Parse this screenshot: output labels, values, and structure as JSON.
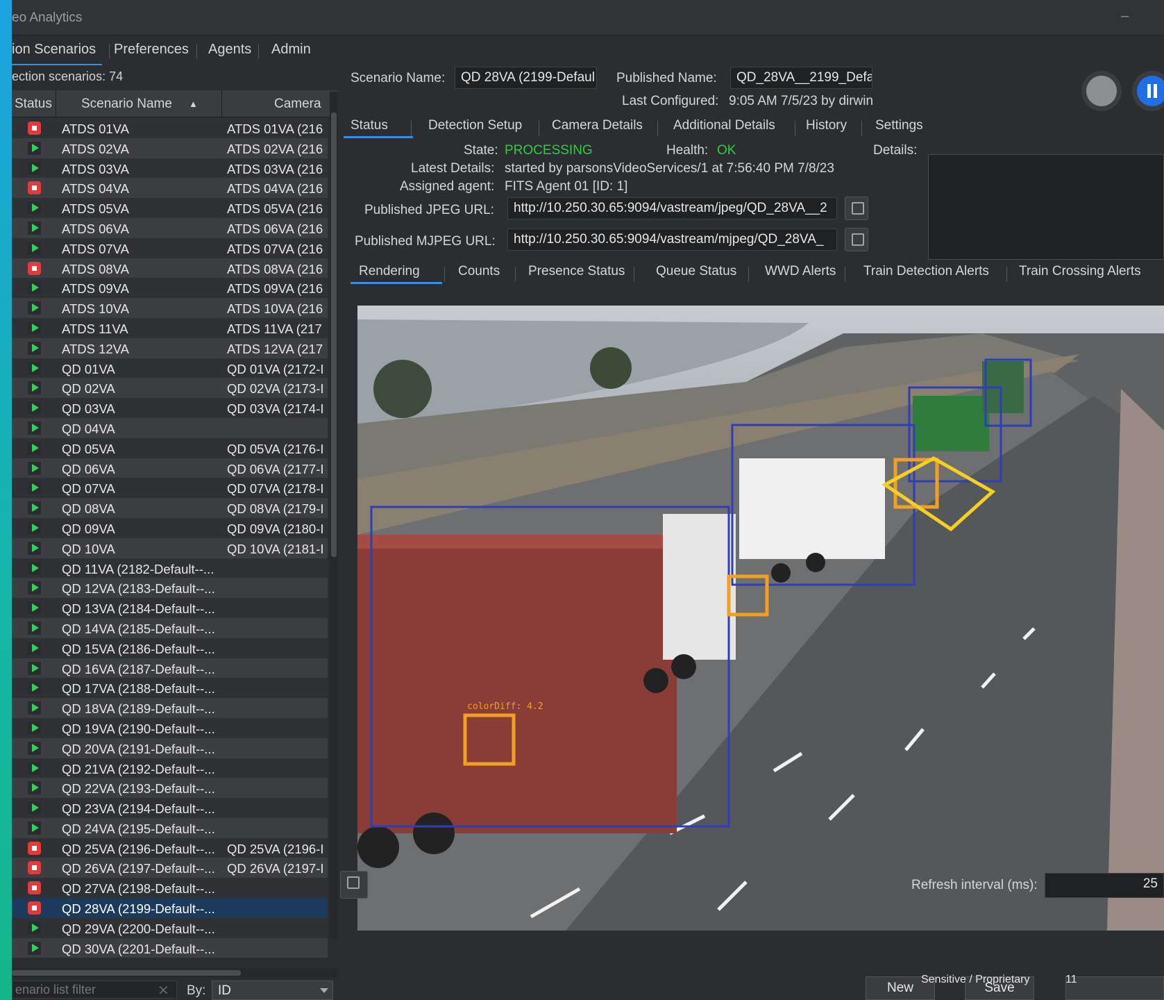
{
  "window": {
    "title": "eo Analytics"
  },
  "nav": {
    "tabs": [
      "ion Scenarios",
      "Preferences",
      "Agents",
      "Admin"
    ]
  },
  "left": {
    "count_label": "ection scenarios: 74",
    "headers": {
      "status": "Status",
      "name": "Scenario Name",
      "camera": "Camera"
    },
    "rows": [
      {
        "status": "stopped",
        "name": "ATDS 01VA",
        "camera": "ATDS 01VA (216"
      },
      {
        "status": "running",
        "name": "ATDS 02VA",
        "camera": "ATDS 02VA (216"
      },
      {
        "status": "running",
        "name": "ATDS 03VA",
        "camera": "ATDS 03VA (216"
      },
      {
        "status": "stopped",
        "name": "ATDS 04VA",
        "camera": "ATDS 04VA (216"
      },
      {
        "status": "running",
        "name": "ATDS 05VA",
        "camera": "ATDS 05VA (216"
      },
      {
        "status": "running",
        "name": "ATDS 06VA",
        "camera": "ATDS 06VA (216"
      },
      {
        "status": "running",
        "name": "ATDS 07VA",
        "camera": "ATDS 07VA (216"
      },
      {
        "status": "stopped",
        "name": "ATDS 08VA",
        "camera": "ATDS 08VA (216"
      },
      {
        "status": "running",
        "name": "ATDS 09VA",
        "camera": "ATDS 09VA (216"
      },
      {
        "status": "running",
        "name": "ATDS 10VA",
        "camera": "ATDS 10VA (216"
      },
      {
        "status": "running",
        "name": "ATDS 11VA",
        "camera": "ATDS 11VA (217"
      },
      {
        "status": "running",
        "name": "ATDS 12VA",
        "camera": "ATDS 12VA (217"
      },
      {
        "status": "running",
        "name": "QD 01VA",
        "camera": "QD 01VA (2172-I"
      },
      {
        "status": "running",
        "name": "QD 02VA",
        "camera": "QD 02VA (2173-I"
      },
      {
        "status": "running",
        "name": "QD 03VA",
        "camera": "QD 03VA (2174-I"
      },
      {
        "status": "running",
        "name": "QD 04VA",
        "camera": ""
      },
      {
        "status": "running",
        "name": "QD 05VA",
        "camera": "QD 05VA (2176-I"
      },
      {
        "status": "running",
        "name": "QD 06VA",
        "camera": "QD 06VA (2177-I"
      },
      {
        "status": "running",
        "name": "QD 07VA",
        "camera": "QD 07VA (2178-I"
      },
      {
        "status": "running",
        "name": "QD 08VA",
        "camera": "QD 08VA (2179-I"
      },
      {
        "status": "running",
        "name": "QD 09VA",
        "camera": "QD 09VA (2180-I"
      },
      {
        "status": "running",
        "name": "QD 10VA",
        "camera": "QD 10VA (2181-I"
      },
      {
        "status": "running",
        "name": "QD 11VA (2182-Default--...",
        "camera": ""
      },
      {
        "status": "running",
        "name": "QD 12VA (2183-Default--...",
        "camera": ""
      },
      {
        "status": "running",
        "name": "QD 13VA (2184-Default--...",
        "camera": ""
      },
      {
        "status": "running",
        "name": "QD 14VA (2185-Default--...",
        "camera": ""
      },
      {
        "status": "running",
        "name": "QD 15VA (2186-Default--...",
        "camera": ""
      },
      {
        "status": "running",
        "name": "QD 16VA (2187-Default--...",
        "camera": ""
      },
      {
        "status": "running",
        "name": "QD 17VA (2188-Default--...",
        "camera": ""
      },
      {
        "status": "running",
        "name": "QD 18VA (2189-Default--...",
        "camera": ""
      },
      {
        "status": "running",
        "name": "QD 19VA (2190-Default--...",
        "camera": ""
      },
      {
        "status": "running",
        "name": "QD 20VA (2191-Default--...",
        "camera": ""
      },
      {
        "status": "running",
        "name": "QD 21VA (2192-Default--...",
        "camera": ""
      },
      {
        "status": "running",
        "name": "QD 22VA (2193-Default--...",
        "camera": ""
      },
      {
        "status": "running",
        "name": "QD 23VA (2194-Default--...",
        "camera": ""
      },
      {
        "status": "running",
        "name": "QD 24VA (2195-Default--...",
        "camera": ""
      },
      {
        "status": "stopped",
        "name": "QD 25VA (2196-Default--...",
        "camera": "QD 25VA (2196-I"
      },
      {
        "status": "stopped",
        "name": "QD 26VA (2197-Default--...",
        "camera": "QD 26VA (2197-I"
      },
      {
        "status": "stopped",
        "name": "QD 27VA (2198-Default--...",
        "camera": ""
      },
      {
        "status": "stopped",
        "name": "QD 28VA (2199-Default--...",
        "camera": "",
        "selected": true
      },
      {
        "status": "running",
        "name": "QD 29VA (2200-Default--...",
        "camera": ""
      },
      {
        "status": "running",
        "name": "QD 30VA (2201-Default--...",
        "camera": ""
      }
    ],
    "filter_placeholder": "enario list filter",
    "by_label": "By:",
    "by_value": "ID"
  },
  "scenario": {
    "name_label": "Scenario Name:",
    "name_value": "QD 28VA (2199-Defaul",
    "published_label": "Published Name:",
    "published_value": "QD_28VA__2199_Defa",
    "last_configured_label": "Last Configured:",
    "last_configured_value": "9:05 AM 7/5/23 by dirwin"
  },
  "tabs": [
    "Status",
    "Detection Setup",
    "Camera Details",
    "Additional Details",
    "History",
    "Settings"
  ],
  "status": {
    "state_label": "State:",
    "state_value": "PROCESSING",
    "health_label": "Health:",
    "health_value": "OK",
    "details_label": "Details:",
    "latest_label": "Latest Details:",
    "latest_value": "started by parsonsVideoServices/1 at 7:56:40 PM 7/8/23",
    "agent_label": "Assigned agent:",
    "agent_value": "FITS Agent 01 [ID: 1]",
    "jpeg_label": "Published JPEG URL:",
    "jpeg_value": "http://10.250.30.65:9094/vastream/jpeg/QD_28VA__2",
    "mjpeg_label": "Published MJPEG URL:",
    "mjpeg_value": "http://10.250.30.65:9094/vastream/mjpeg/QD_28VA_"
  },
  "render_tabs": [
    "Rendering",
    "Counts",
    "Presence Status",
    "Queue Status",
    "WWD Alerts",
    "Train Detection Alerts",
    "Train Crossing Alerts"
  ],
  "video": {
    "overlay_labels": [
      "colorDiff: 4.2"
    ]
  },
  "footer": {
    "refresh_label": "Refresh interval (ms):",
    "refresh_value": "25",
    "new_label": "New",
    "save_label": "Save",
    "sensitive": "Sensitive / Proprietary",
    "page": "11"
  },
  "colors": {
    "accent": "#3a8ee0",
    "running": "#2fd35a",
    "stopped": "#e33b3b",
    "ok": "#2ccf3e",
    "pause": "#1f6fe6"
  }
}
